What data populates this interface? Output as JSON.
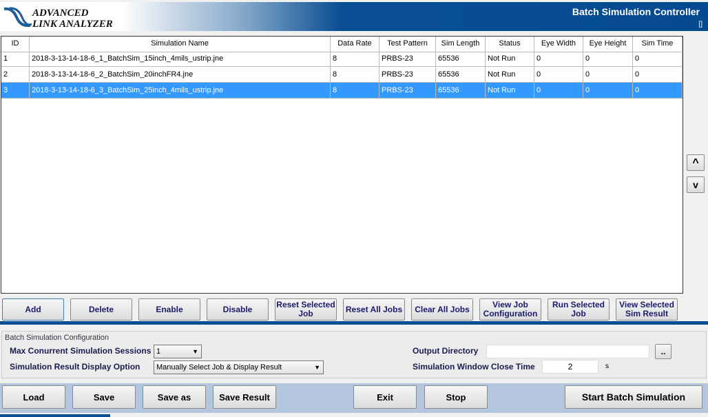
{
  "header": {
    "logo_line1": "ADVANCED",
    "logo_line2": "LINK ANALYZER",
    "title": "Batch Simulation Controller",
    "restore_icon": "[]"
  },
  "table": {
    "columns": [
      "ID",
      "Simulation Name",
      "Data Rate",
      "Test Pattern",
      "Sim Length",
      "Status",
      "Eye Width",
      "Eye Height",
      "Sim Time"
    ],
    "rows": [
      [
        "1",
        "2018-3-13-14-18-6_1_BatchSim_15inch_4mils_ustrip.jne",
        "8",
        "PRBS-23",
        "65536",
        "Not Run",
        "0",
        "0",
        "0"
      ],
      [
        "2",
        "2018-3-13-14-18-6_2_BatchSim_20inchFR4.jne",
        "8",
        "PRBS-23",
        "65536",
        "Not Run",
        "0",
        "0",
        "0"
      ],
      [
        "3",
        "2018-3-13-14-18-6_3_BatchSim_25inch_4mils_ustrip.jne",
        "8",
        "PRBS-23",
        "65536",
        "Not Run",
        "0",
        "0",
        "0"
      ]
    ],
    "selected_row": 3
  },
  "scroll": {
    "up": "^",
    "down": "v"
  },
  "actions": [
    "Add",
    "Delete",
    "Enable",
    "Disable",
    "Reset Selected Job",
    "Reset All Jobs",
    "Clear All Jobs",
    "View Job Configuration",
    "Run Selected Job",
    "View Selected Sim Result"
  ],
  "config": {
    "title": "Batch Simulation Configuration",
    "max_sessions_label": "Max Conurrent Simulation Sessions",
    "max_sessions_value": "1",
    "display_option_label": "Simulation Result Display Option",
    "display_option_value": "Manually Select Job & Display Result",
    "output_dir_label": "Output Directory",
    "output_dir_value": "",
    "browse_label": "..",
    "close_time_label": "Simulation Window Close Time",
    "close_time_value": "2",
    "close_time_unit": "s"
  },
  "bottom": {
    "load": "Load",
    "save": "Save",
    "save_as": "Save as",
    "save_result": "Save Result",
    "exit": "Exit",
    "stop": "Stop",
    "start": "Start Batch Simulation"
  },
  "colors": {
    "brand": "#0a4f94",
    "selection": "#3399ff",
    "bottom_bar": "#b3c6dd"
  }
}
